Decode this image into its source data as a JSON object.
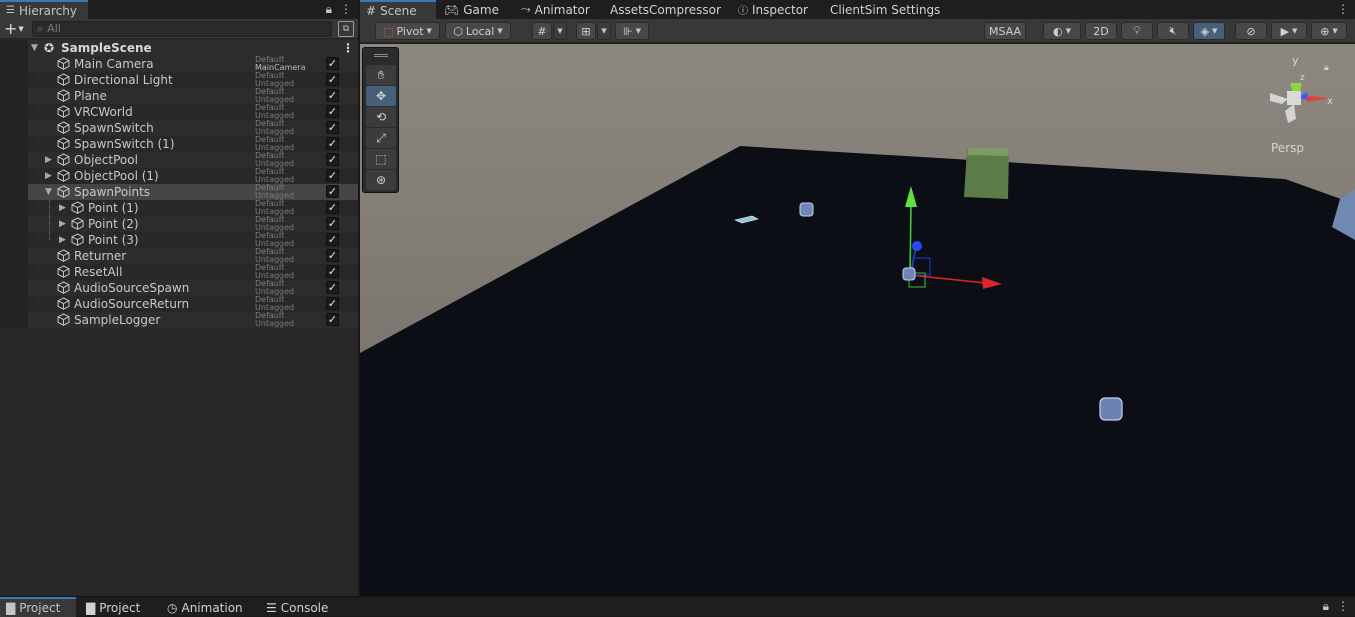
{
  "hierarchy": {
    "tab_label": "Hierarchy",
    "add_label": "+",
    "search_placeholder": "All",
    "scene_name": "SampleScene",
    "items": [
      {
        "name": "Main Camera",
        "layer": "Default",
        "tag": "MainCamera",
        "expandable": false,
        "depth": 0
      },
      {
        "name": "Directional Light",
        "layer": "Default",
        "tag": "Untagged",
        "expandable": false,
        "depth": 0
      },
      {
        "name": "Plane",
        "layer": "Default",
        "tag": "Untagged",
        "expandable": false,
        "depth": 0
      },
      {
        "name": "VRCWorld",
        "layer": "Default",
        "tag": "Untagged",
        "expandable": false,
        "depth": 0
      },
      {
        "name": "SpawnSwitch",
        "layer": "Default",
        "tag": "Untagged",
        "expandable": false,
        "depth": 0
      },
      {
        "name": "SpawnSwitch (1)",
        "layer": "Default",
        "tag": "Untagged",
        "expandable": false,
        "depth": 0
      },
      {
        "name": "ObjectPool",
        "layer": "Default",
        "tag": "Untagged",
        "expandable": true,
        "depth": 0
      },
      {
        "name": "ObjectPool (1)",
        "layer": "Default",
        "tag": "Untagged",
        "expandable": true,
        "depth": 0
      },
      {
        "name": "SpawnPoints",
        "layer": "Default",
        "tag": "Untagged",
        "expandable": true,
        "expanded": true,
        "selected": true,
        "depth": 0
      },
      {
        "name": "Point (1)",
        "layer": "Default",
        "tag": "Untagged",
        "expandable": true,
        "depth": 1
      },
      {
        "name": "Point (2)",
        "layer": "Default",
        "tag": "Untagged",
        "expandable": true,
        "depth": 1
      },
      {
        "name": "Point (3)",
        "layer": "Default",
        "tag": "Untagged",
        "expandable": true,
        "depth": 1
      },
      {
        "name": "Returner",
        "layer": "Default",
        "tag": "Untagged",
        "expandable": false,
        "depth": 0
      },
      {
        "name": "ResetAll",
        "layer": "Default",
        "tag": "Untagged",
        "expandable": false,
        "depth": 0
      },
      {
        "name": "AudioSourceSpawn",
        "layer": "Default",
        "tag": "Untagged",
        "expandable": false,
        "depth": 0
      },
      {
        "name": "AudioSourceReturn",
        "layer": "Default",
        "tag": "Untagged",
        "expandable": false,
        "depth": 0
      },
      {
        "name": "SampleLogger",
        "layer": "Default",
        "tag": "Untagged",
        "expandable": false,
        "depth": 0
      }
    ]
  },
  "scene_tabs": {
    "scene": "Scene",
    "game": "Game",
    "animator": "Animator",
    "assets_compressor": "AssetsCompressor",
    "inspector": "Inspector",
    "clientsim": "ClientSim Settings"
  },
  "scene_toolbar": {
    "pivot": "Pivot",
    "local": "Local",
    "msaa": "MSAA",
    "two_d": "2D"
  },
  "gizmo": {
    "y": "y",
    "z": "z",
    "x": "x",
    "persp": "Persp"
  },
  "bottom_tabs": {
    "project1": "Project",
    "project2": "Project",
    "animation": "Animation",
    "console": "Console"
  },
  "colors": {
    "accent": "#3a79bb",
    "selection": "#46607c",
    "sky": "#7f7a72",
    "ground": "#0b0e15"
  }
}
